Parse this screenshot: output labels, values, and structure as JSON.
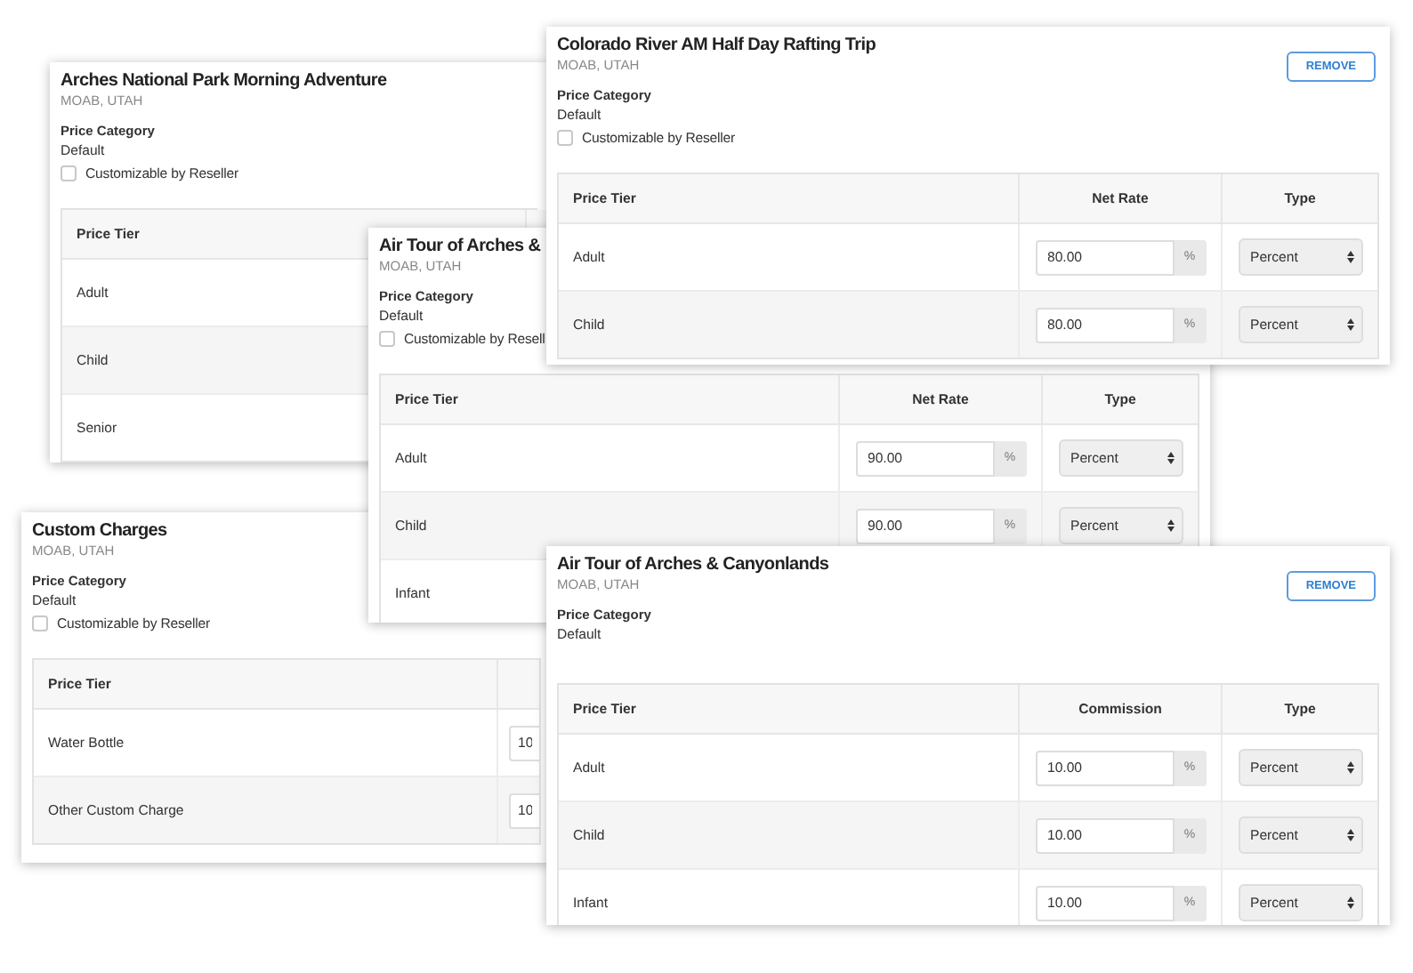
{
  "cards": [
    {
      "title": "Arches National Park Morning Adventure",
      "location": "MOAB, UTAH",
      "category_label": "Price Category",
      "category": "Default",
      "customizable": {
        "label": "Customizable by Reseller",
        "checked": false
      },
      "table": {
        "columns": [
          "Price Tier"
        ],
        "rows": [
          {
            "tier": "Adult"
          },
          {
            "tier": "Child"
          },
          {
            "tier": "Senior"
          }
        ]
      }
    },
    {
      "title": "Colorado River AM Half Day Rafting Trip",
      "location": "MOAB, UTAH",
      "category_label": "Price Category",
      "category": "Default",
      "customizable": {
        "label": "Customizable by Reseller",
        "checked": false
      },
      "remove": "REMOVE",
      "table": {
        "columns": [
          "Price Tier",
          "Net Rate",
          "Type"
        ],
        "rows": [
          {
            "tier": "Adult",
            "value": "80.00",
            "unit": "%",
            "type": "Percent"
          },
          {
            "tier": "Child",
            "value": "80.00",
            "unit": "%",
            "type": "Percent"
          }
        ]
      }
    },
    {
      "title": "Air Tour of Arches &",
      "location": "MOAB, UTAH",
      "category_label": "Price Category",
      "category": "Default",
      "customizable": {
        "label": "Customizable by Resell",
        "checked": false
      },
      "table": {
        "columns": [
          "Price Tier",
          "Net Rate",
          "Type"
        ],
        "rows": [
          {
            "tier": "Adult",
            "value": "90.00",
            "unit": "%",
            "type": "Percent"
          },
          {
            "tier": "Child",
            "value": "90.00",
            "unit": "%",
            "type": "Percent"
          },
          {
            "tier": "Infant"
          }
        ]
      }
    },
    {
      "title": "Custom Charges",
      "location": "MOAB, UTAH",
      "category_label": "Price Category",
      "category": "Default",
      "customizable": {
        "label": "Customizable by Reseller",
        "checked": false
      },
      "table": {
        "columns": [
          "Price Tier"
        ],
        "rows": [
          {
            "tier": "Water Bottle",
            "value": "10"
          },
          {
            "tier": "Other Custom Charge",
            "value": "10"
          }
        ]
      }
    },
    {
      "title": "Air Tour of Arches & Canyonlands",
      "location": "MOAB, UTAH",
      "category_label": "Price Category",
      "category": "Default",
      "remove": "REMOVE",
      "table": {
        "columns": [
          "Price Tier",
          "Commission",
          "Type"
        ],
        "rows": [
          {
            "tier": "Adult",
            "value": "10.00",
            "unit": "%",
            "type": "Percent"
          },
          {
            "tier": "Child",
            "value": "10.00",
            "unit": "%",
            "type": "Percent"
          },
          {
            "tier": "Infant",
            "value": "10.00",
            "unit": "%",
            "type": "Percent"
          }
        ]
      }
    }
  ]
}
